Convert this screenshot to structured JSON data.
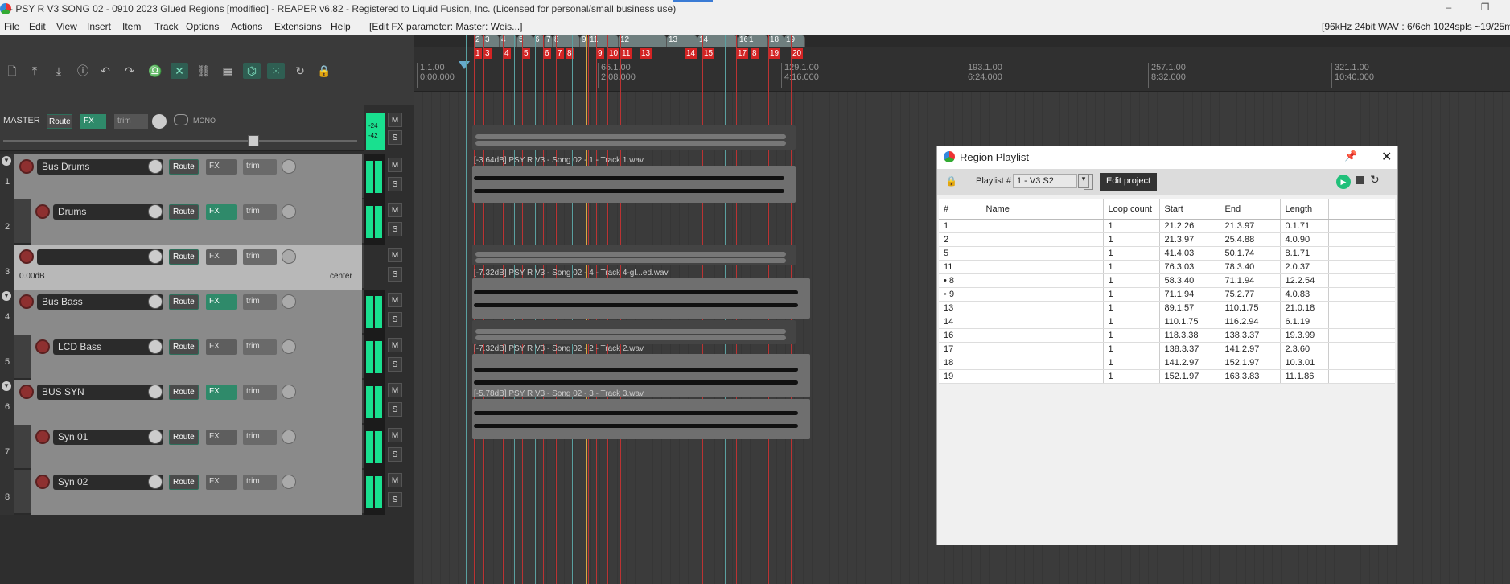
{
  "titlebar": {
    "title": "- PSY R V3 SONG 02 - 0910 2023 Glued Regions [modified] - REAPER v6.82 - Registered to Liquid Fusion, Inc. (Licensed for personal/small business use)"
  },
  "menu": {
    "items": [
      "File",
      "Edit",
      "View",
      "Insert",
      "Item",
      "Track",
      "Options",
      "Actions",
      "Extensions",
      "Help"
    ],
    "status": "[Edit FX parameter: Master: Weis...]",
    "right_info": "[96kHz 24bit WAV : 6/6ch 1024spls ~19/25ms"
  },
  "toolbar": {
    "icons": [
      "new-project-icon",
      "open-icon",
      "save-icon",
      "properties-icon",
      "undo-icon",
      "redo-icon",
      "metronome-icon",
      "ripple-icon",
      "link-icon",
      "grid-icon",
      "snap-icon",
      "grid2-icon",
      "loop-icon",
      "lock-icon"
    ]
  },
  "master": {
    "label": "MASTER",
    "route": "Route",
    "fx": "FX",
    "trim": "trim",
    "mono": "MONO",
    "meter_labels": [
      "-24",
      "-42",
      "-"
    ],
    "mute": "M",
    "solo": "S"
  },
  "tracks": [
    {
      "num": "1",
      "name": "Bus Drums",
      "route": "Route",
      "fx": "FX",
      "trim": "trim",
      "child": false,
      "folder": true,
      "fx_on": false
    },
    {
      "num": "2",
      "name": "Drums",
      "route": "Route",
      "fx": "FX",
      "trim": "trim",
      "child": true,
      "folder": false,
      "fx_on": true
    },
    {
      "num": "3",
      "name": "",
      "route": "Route",
      "fx": "FX",
      "trim": "trim",
      "child": false,
      "folder": false,
      "fx_on": false,
      "volume": "0.00dB",
      "pan": "center"
    },
    {
      "num": "4",
      "name": "Bus Bass",
      "route": "Route",
      "fx": "FX",
      "trim": "trim",
      "child": false,
      "folder": true,
      "fx_on": true
    },
    {
      "num": "5",
      "name": "LCD Bass",
      "route": "Route",
      "fx": "FX",
      "trim": "trim",
      "child": true,
      "folder": false,
      "fx_on": false
    },
    {
      "num": "6",
      "name": "BUS SYN",
      "route": "Route",
      "fx": "FX",
      "trim": "trim",
      "child": false,
      "folder": true,
      "fx_on": true
    },
    {
      "num": "7",
      "name": "Syn 01",
      "route": "Route",
      "fx": "FX",
      "trim": "trim",
      "child": true,
      "folder": false,
      "fx_on": false
    },
    {
      "num": "8",
      "name": "Syn 02",
      "route": "Route",
      "fx": "FX",
      "trim": "trim",
      "child": true,
      "folder": false,
      "fx_on": false
    }
  ],
  "region_tabs": [
    "2",
    "3",
    "4",
    "5",
    "6",
    "7",
    "8",
    "9",
    "11",
    "12",
    "13",
    "14",
    "16",
    "1",
    "18",
    "19"
  ],
  "markers": [
    "1",
    "3",
    "4",
    "5",
    "6",
    "7",
    "8",
    "9",
    "10",
    "11",
    "13",
    "14",
    "15",
    "17",
    "8",
    "19",
    "20"
  ],
  "ruler": [
    {
      "bar": "1.1.00",
      "time": "0:00.000"
    },
    {
      "bar": "65.1.00",
      "time": "2:08.000"
    },
    {
      "bar": "129.1.00",
      "time": "4:16.000"
    },
    {
      "bar": "193.1.00",
      "time": "6:24.000"
    },
    {
      "bar": "257.1.00",
      "time": "8:32.000"
    },
    {
      "bar": "321.1.00",
      "time": "10:40.000"
    }
  ],
  "items": [
    {
      "label": "[-3.64dB] PSY R V3 - Song 02 - 1 - Track 1.wav"
    },
    {
      "label": "[-7.32dB] PSY R V3 - Song 02 - 4 - Track 4-gl...ed.wav"
    },
    {
      "label": "[-7.32dB] PSY R V3 - Song 02 - 2 - Track 2.wav"
    },
    {
      "label": "[-5.78dB] PSY R V3 - Song 02 - 3 - Track 3.wav"
    }
  ],
  "region_playlist": {
    "title": "Region Playlist",
    "playlist_label": "Playlist #",
    "playlist_value": "1 - V3 S2",
    "edit_project": "Edit project",
    "columns": [
      "#",
      "Name",
      "Loop count",
      "Start",
      "End",
      "Length"
    ],
    "rows": [
      {
        "num": "1",
        "name": "",
        "loop": "1",
        "start": "21.2.26",
        "end": "21.3.97",
        "length": "0.1.71"
      },
      {
        "num": "2",
        "name": "",
        "loop": "1",
        "start": "21.3.97",
        "end": "25.4.88",
        "length": "4.0.90"
      },
      {
        "num": "5",
        "name": "",
        "loop": "1",
        "start": "41.4.03",
        "end": "50.1.74",
        "length": "8.1.71"
      },
      {
        "num": "11",
        "name": "",
        "loop": "1",
        "start": "76.3.03",
        "end": "78.3.40",
        "length": "2.0.37"
      },
      {
        "num": "• 8",
        "name": "",
        "loop": "1",
        "start": "58.3.40",
        "end": "71.1.94",
        "length": "12.2.54"
      },
      {
        "num": "◦ 9",
        "name": "",
        "loop": "1",
        "start": "71.1.94",
        "end": "75.2.77",
        "length": "4.0.83"
      },
      {
        "num": "13",
        "name": "",
        "loop": "1",
        "start": "89.1.57",
        "end": "110.1.75",
        "length": "21.0.18"
      },
      {
        "num": "14",
        "name": "",
        "loop": "1",
        "start": "110.1.75",
        "end": "116.2.94",
        "length": "6.1.19"
      },
      {
        "num": "16",
        "name": "",
        "loop": "1",
        "start": "118.3.38",
        "end": "138.3.37",
        "length": "19.3.99"
      },
      {
        "num": "17",
        "name": "",
        "loop": "1",
        "start": "138.3.37",
        "end": "141.2.97",
        "length": "2.3.60"
      },
      {
        "num": "18",
        "name": "",
        "loop": "1",
        "start": "141.2.97",
        "end": "152.1.97",
        "length": "10.3.01"
      },
      {
        "num": "19",
        "name": "",
        "loop": "1",
        "start": "152.1.97",
        "end": "163.3.83",
        "length": "11.1.86"
      }
    ]
  },
  "colors": {
    "accent_green": "#19e08f",
    "marker_red": "#d32424",
    "fx_on": "#2f8a6a",
    "play_green": "#21c07a"
  }
}
